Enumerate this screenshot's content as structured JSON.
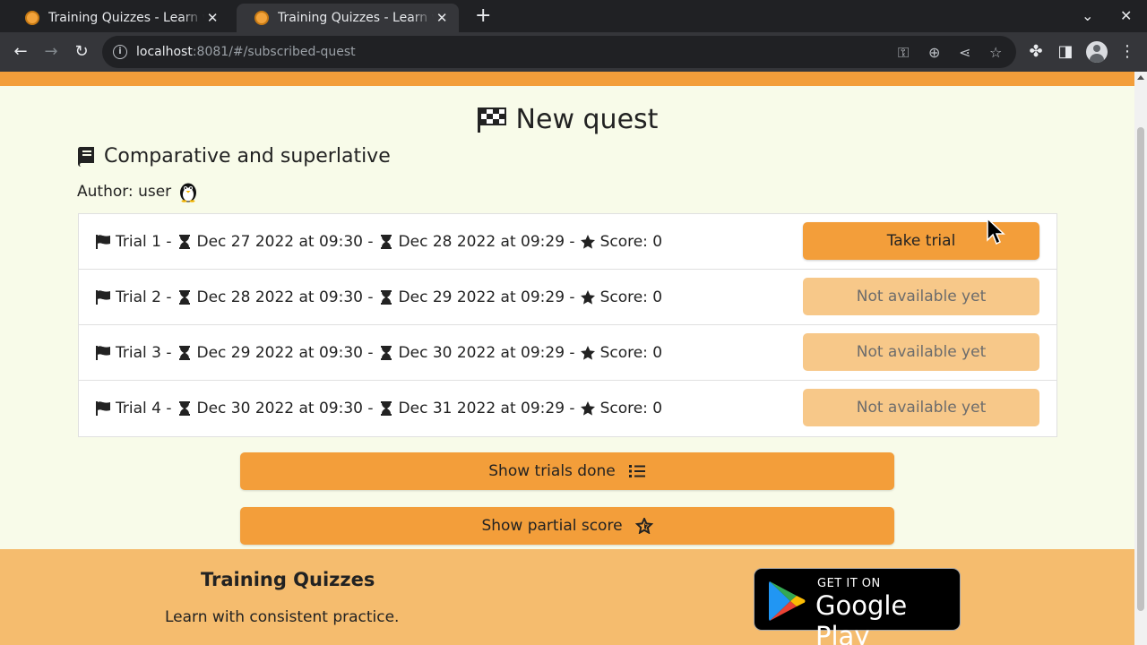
{
  "browser": {
    "tabs": [
      {
        "title": "Training Quizzes - Learn with consistent practice",
        "active": false
      },
      {
        "title": "Training Quizzes - Learn with consistent practice",
        "active": true
      }
    ],
    "url_host": "localhost",
    "url_path": ":8081/#/subscribed-quest"
  },
  "page": {
    "title": "New quest",
    "quiz_title": "Comparative and superlative",
    "author_label": "Author: user",
    "trials": [
      {
        "name": "Trial 1 -",
        "start": "Dec 27 2022 at 09:30 -",
        "end": "Dec 28 2022 at 09:29 -",
        "score": "Score: 0",
        "button": "Take trial",
        "enabled": true
      },
      {
        "name": "Trial 2 -",
        "start": "Dec 28 2022 at 09:30 -",
        "end": "Dec 29 2022 at 09:29 -",
        "score": "Score: 0",
        "button": "Not available yet",
        "enabled": false
      },
      {
        "name": "Trial 3 -",
        "start": "Dec 29 2022 at 09:30 -",
        "end": "Dec 30 2022 at 09:29 -",
        "score": "Score: 0",
        "button": "Not available yet",
        "enabled": false
      },
      {
        "name": "Trial 4 -",
        "start": "Dec 30 2022 at 09:30 -",
        "end": "Dec 31 2022 at 09:29 -",
        "score": "Score: 0",
        "button": "Not available yet",
        "enabled": false
      }
    ],
    "show_trials_done": "Show trials done",
    "show_partial_score": "Show partial score"
  },
  "footer": {
    "brand": "Training Quizzes",
    "tagline": "Learn with consistent practice.",
    "store_small": "GET IT ON",
    "store_big": "Google Play"
  },
  "colors": {
    "accent": "#f39e3a",
    "accent_disabled": "#f7c889",
    "footer_bg": "#f5bc6e",
    "page_bg": "#f8fbe9"
  }
}
